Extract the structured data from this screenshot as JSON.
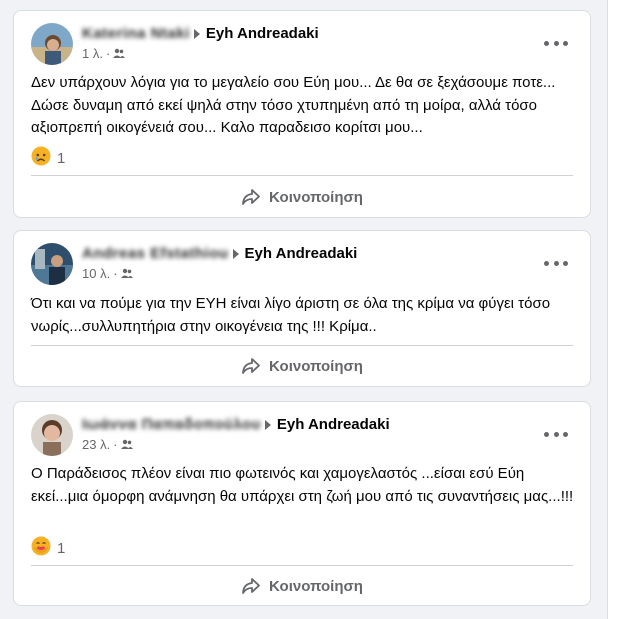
{
  "posts": [
    {
      "author_name": "Katerina Ntaki",
      "target_name": "Eyh Andreadaki",
      "time": "1 λ.",
      "audience_icon": "friends-icon",
      "text": "Δεν υπάρχουν λόγια για το μεγαλείο σου Εύη μου... Δε θα σε ξεχάσουμε ποτε... Δώσε δυναμη από εκεί ψηλά στην τόσο χτυπημένη από τη μοίρα, αλλά τόσο αξιοπρεπή οικογένειά σου... Καλο παραδεισο κορίτσι μου...",
      "reaction_icon": "sad-reaction-icon",
      "reaction_count": "1",
      "share_label": "Κοινοποίηση"
    },
    {
      "author_name": "Andreas Efstathiou",
      "target_name": "Eyh Andreadaki",
      "time": "10 λ.",
      "audience_icon": "friends-icon",
      "text": "Ότι και να πούμε για την ΕΥΗ είναι λίγο άριστη σε όλα της κρίμα να φύγει τόσο νωρίς...συλλυπητήρια στην οικογένεια της !!! Κρίμα..",
      "share_label": "Κοινοποίηση"
    },
    {
      "author_name": "Ιωάννα Παπαδοπούλου",
      "target_name": "Eyh Andreadaki",
      "time": "23 λ.",
      "audience_icon": "friends-icon",
      "text": "Ο Παράδεισος πλέον είναι πιο φωτεινός και χαμογελαστός ...είσαι εσύ Εύη εκεί...μια όμορφη ανάμνηση θα υπάρχει στη ζωή μου από τις συναντήσεις μας...!!!",
      "reaction_icon": "care-reaction-icon",
      "reaction_count": "1",
      "share_label": "Κοινοποίηση"
    }
  ]
}
